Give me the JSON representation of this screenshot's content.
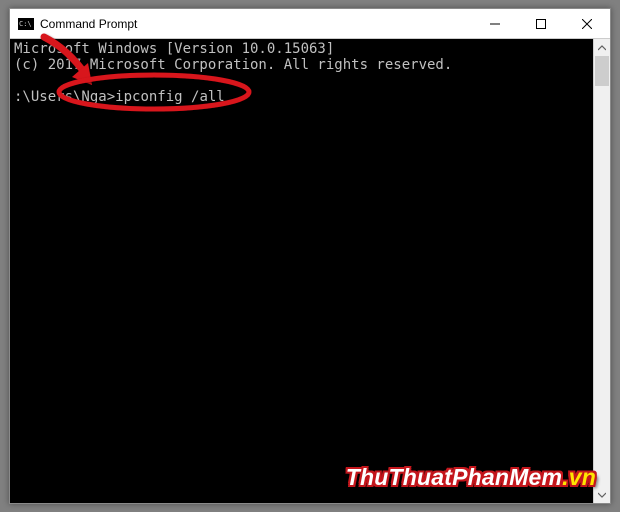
{
  "window": {
    "title": "Command Prompt"
  },
  "console": {
    "line1": "Microsoft Windows [Version 10.0.15063]",
    "line2": "(c) 2017 Microsoft Corporation. All rights reserved.",
    "blank": "",
    "prompt": ":\\Users\\Nga>",
    "command": "ipconfig /all"
  },
  "watermark": {
    "main": "ThuThuatPhanMem",
    "suffix": ".vn"
  },
  "annotation": {
    "arrow_color": "#d8121b",
    "ellipse_color": "#d8121b"
  }
}
